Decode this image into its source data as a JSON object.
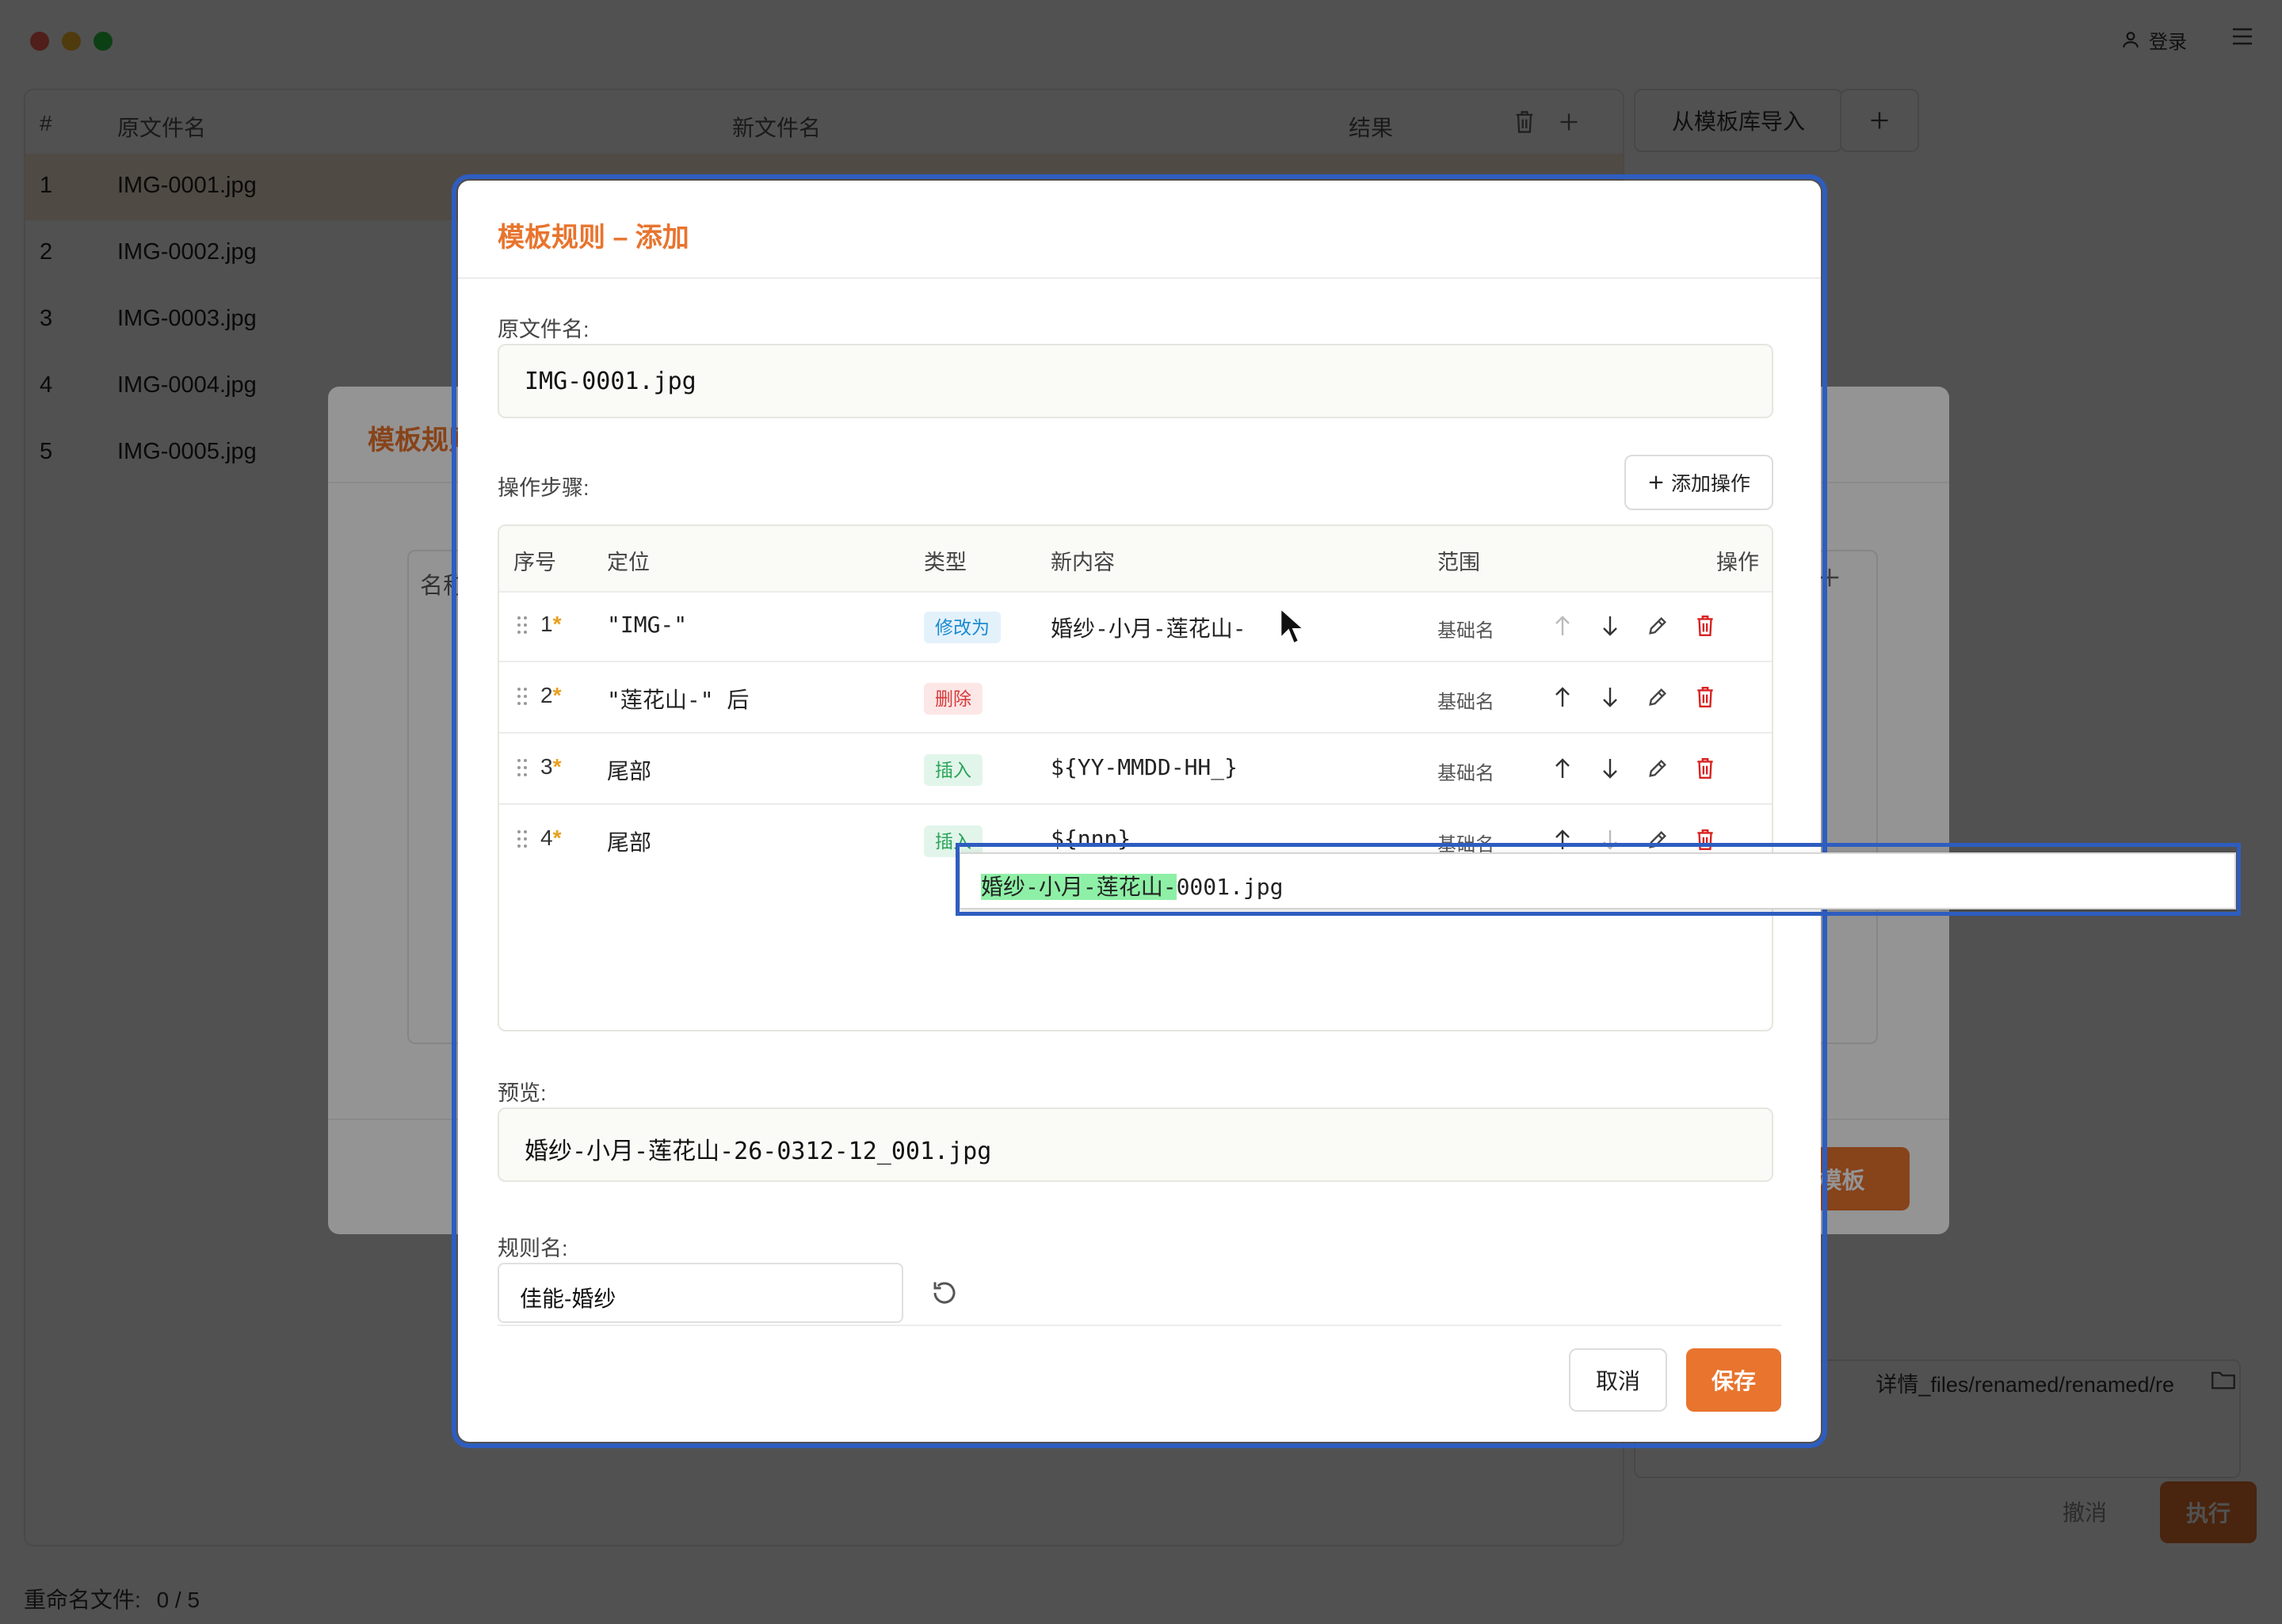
{
  "topbar": {
    "login_label": "登录"
  },
  "file_table": {
    "headers": [
      "#",
      "原文件名",
      "新文件名",
      "结果"
    ],
    "rows": [
      {
        "index": "1",
        "name": "IMG-0001.jpg"
      },
      {
        "index": "2",
        "name": "IMG-0002.jpg"
      },
      {
        "index": "3",
        "name": "IMG-0003.jpg"
      },
      {
        "index": "4",
        "name": "IMG-0004.jpg"
      },
      {
        "index": "5",
        "name": "IMG-0005.jpg"
      }
    ]
  },
  "right_panel": {
    "import_label": "从模板库导入",
    "output_path": "详情_files/renamed/renamed/re",
    "undo_label": "撤消",
    "execute_label": "执行"
  },
  "status": {
    "label": "重命名文件:",
    "value": "0 / 5"
  },
  "mid_dialog": {
    "title": "模板规则",
    "name_label": "名称",
    "apply_label": "用模板"
  },
  "dialog": {
    "title": "模板规则 – 添加",
    "original_label": "原文件名:",
    "original_value": "IMG-0001.jpg",
    "steps_label": "操作步骤:",
    "add_op_label": "添加操作",
    "step_headers": {
      "index": "序号",
      "position": "定位",
      "type": "类型",
      "content": "新内容",
      "scope": "范围",
      "actions": "操作"
    },
    "steps": [
      {
        "index": "1",
        "star": "*",
        "position": "\"IMG-\"",
        "type": "修改为",
        "type_color": "#1a8bd0",
        "content": "婚纱-小月-莲花山-",
        "scope": "基础名"
      },
      {
        "index": "2",
        "star": "*",
        "position": "\"莲花山-\" 后",
        "type": "删除",
        "type_color": "#d63a3a",
        "content": "",
        "scope": "基础名"
      },
      {
        "index": "3",
        "star": "*",
        "position": "尾部",
        "type": "插入",
        "type_color": "#2aa55a",
        "content": "${YY-MMDD-HH_}",
        "scope": "基础名"
      },
      {
        "index": "4",
        "star": "*",
        "position": "尾部",
        "type": "插入",
        "type_color": "#2aa55a",
        "content": "${nnn}",
        "scope": "基础名"
      }
    ],
    "tooltip": {
      "highlight": "婚纱-小月-莲花山-",
      "rest": "0001.jpg"
    },
    "preview_label": "预览:",
    "preview_value": "婚纱-小月-莲花山-26-0312-12_001.jpg",
    "rule_name_label": "规则名:",
    "rule_name_value": "佳能-婚纱",
    "cancel_label": "取消",
    "save_label": "保存"
  },
  "colors": {
    "accent": "#e8742e",
    "focus": "#2e5dc0",
    "highlight": "#8ef0a6"
  }
}
